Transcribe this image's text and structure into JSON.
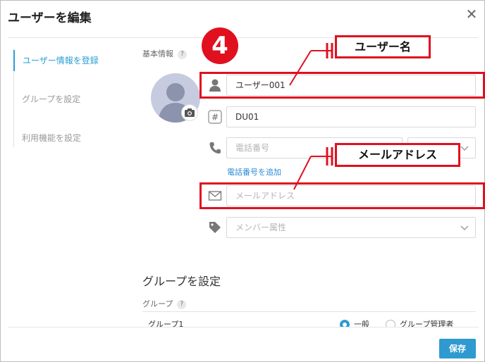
{
  "dialog": {
    "title": "ユーザーを編集",
    "close_glyph": "✕"
  },
  "sidebar": {
    "items": [
      {
        "label": "ユーザー情報を登録",
        "active": true
      },
      {
        "label": "グループを設定",
        "active": false
      },
      {
        "label": "利用機能を設定",
        "active": false
      }
    ]
  },
  "basic_info": {
    "label": "基本情報",
    "help": "?",
    "username": {
      "value": "ユーザー001",
      "icon": "user-icon"
    },
    "code": {
      "value": "DU01",
      "icon": "hash-icon"
    },
    "phone": {
      "placeholder": "電話番号",
      "icon": "phone-icon",
      "add_link": "電話番号を追加"
    },
    "email": {
      "placeholder": "メールアドレス",
      "icon": "mail-icon"
    },
    "member_attr": {
      "placeholder": "メンバー属性",
      "icon": "tag-icon"
    }
  },
  "annotations": {
    "step_number": "4",
    "callout_username": "ユーザー名",
    "callout_email": "メールアドレス",
    "accent": "#e0101f"
  },
  "group_section": {
    "heading": "グループを設定",
    "label": "グループ",
    "help": "?",
    "row": {
      "name": "グループ1",
      "option_general": "一般",
      "option_admin": "グループ管理者"
    }
  },
  "footer": {
    "save_label": "保存",
    "save_color": "#2e9ad0"
  }
}
